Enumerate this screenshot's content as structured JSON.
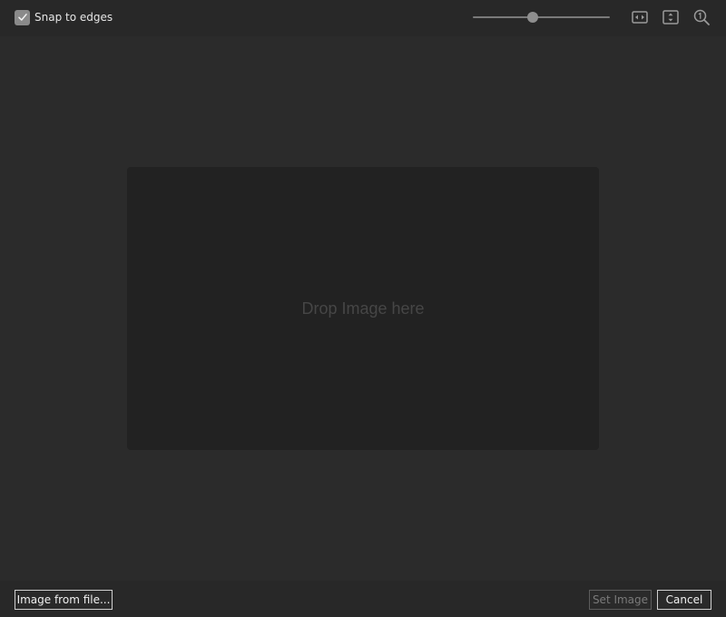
{
  "toolbar": {
    "snap_to_edges": {
      "label": "Snap to edges",
      "checked": true
    },
    "zoom_slider": {
      "value_fraction": 0.44
    },
    "icons": [
      "fit-width-icon",
      "fit-height-icon",
      "actual-size-icon"
    ]
  },
  "canvas": {
    "drop_text": "Drop Image here"
  },
  "footer": {
    "image_from_file_label": "Image from file...",
    "set_image_label": "Set Image",
    "set_image_enabled": false,
    "cancel_label": "Cancel"
  },
  "colors": {
    "window_bg": "#2b2b2b",
    "bar_bg": "#282828",
    "drop_zone_bg": "#222222",
    "checkbox_fill": "#8a8a8a",
    "disabled_text": "#7a7a7a"
  }
}
